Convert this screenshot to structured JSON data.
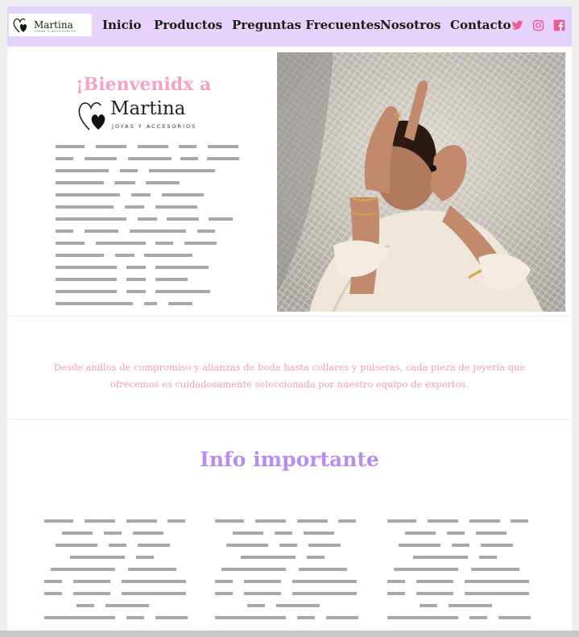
{
  "brand": {
    "name": "Martina",
    "tagline": "JOYAS Y ACCESORIOS"
  },
  "nav": {
    "items": [
      {
        "label": "Inicio"
      },
      {
        "label": "Productos"
      },
      {
        "label": "Preguntas Frecuentes"
      },
      {
        "label": "Nosotros"
      },
      {
        "label": "Contacto"
      }
    ],
    "social": [
      "twitter-icon",
      "instagram-icon",
      "facebook-icon"
    ]
  },
  "hero": {
    "greeting": "¡Bienvenidx a"
  },
  "blurb": "Desde anillos de compromiso y alianzas de boda hasta collares y pulseras, cada pieza de joyería que ofrecemos es cuidadosamente seleccionada por nuestro equipo de expertos.",
  "info": {
    "title": "Info importante"
  },
  "colors": {
    "nav_bg": "#e6d3fb",
    "pink": "#f4a3c8",
    "purple": "#b98cf0",
    "social": "#ee5a8f",
    "placeholder": "#a8a8a8"
  }
}
